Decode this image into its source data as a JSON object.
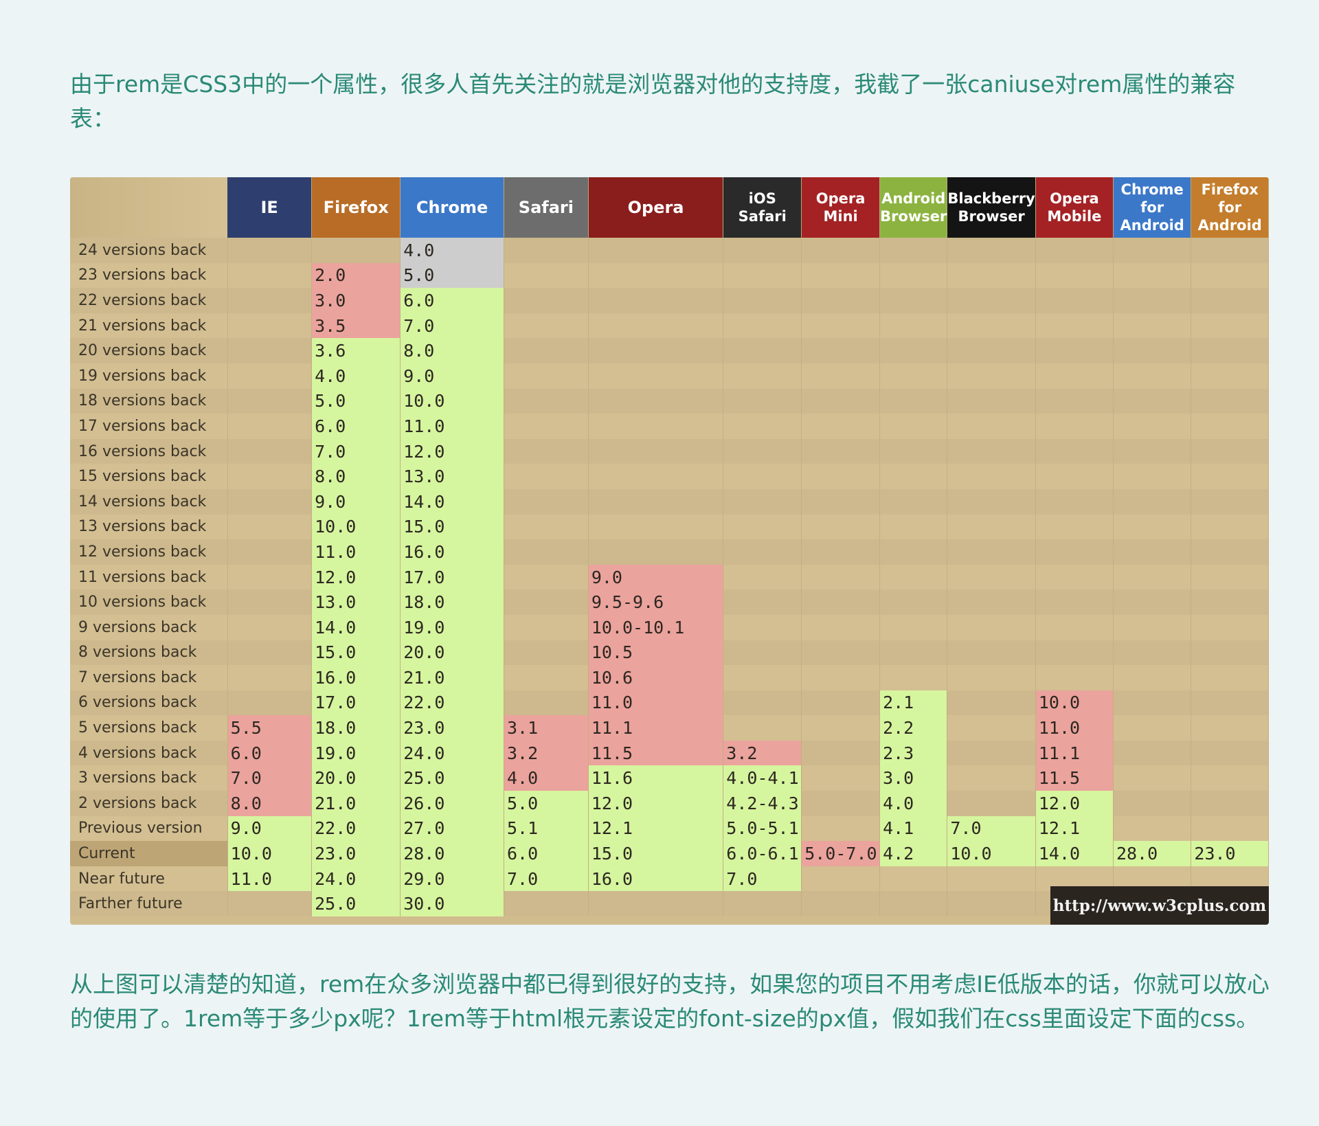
{
  "intro_text": "由于rem是CSS3中的一个属性，很多人首先关注的就是浏览器对他的支持度，我截了一张caniuse对rem属性的兼容表：",
  "outro_text": "从上图可以清楚的知道，rem在众多浏览器中都已得到很好的支持，如果您的项目不用考虑IE低版本的话，你就可以放心的使用了。1rem等于多少px呢？1rem等于html根元素设定的font-size的px值，假如我们在css里面设定下面的css。",
  "credit": "http://www.w3cplus.com",
  "status_colors": {
    "supported": "#d6f59f",
    "not_supported": "#eba39d",
    "unknown": "#cdcdcd"
  },
  "chart_data": {
    "type": "table",
    "columns": [
      {
        "name": "IE",
        "color": "#2e3e6e"
      },
      {
        "name": "Firefox",
        "color": "#b86c26"
      },
      {
        "name": "Chrome",
        "color": "#3c78c8"
      },
      {
        "name": "Safari",
        "color": "#6d6d6d"
      },
      {
        "name": "Opera",
        "color": "#8a1e1c"
      },
      {
        "name": "iOS Safari",
        "color": "#2a2a2a"
      },
      {
        "name": "Opera Mini",
        "color": "#a42224"
      },
      {
        "name": "Android Browser",
        "color": "#8cb340"
      },
      {
        "name": "Blackberry Browser",
        "color": "#141414"
      },
      {
        "name": "Opera Mobile",
        "color": "#a42224"
      },
      {
        "name": "Chrome for Android",
        "color": "#3c78c8"
      },
      {
        "name": "Firefox for Android",
        "color": "#c47d2c"
      }
    ],
    "rows": [
      {
        "label": "24 versions back",
        "cells": [
          null,
          null,
          [
            "4.0",
            "u"
          ],
          null,
          null,
          null,
          null,
          null,
          null,
          null,
          null,
          null
        ]
      },
      {
        "label": "23 versions back",
        "cells": [
          null,
          [
            "2.0",
            "n"
          ],
          [
            "5.0",
            "u"
          ],
          null,
          null,
          null,
          null,
          null,
          null,
          null,
          null,
          null
        ]
      },
      {
        "label": "22 versions back",
        "cells": [
          null,
          [
            "3.0",
            "n"
          ],
          [
            "6.0",
            "y"
          ],
          null,
          null,
          null,
          null,
          null,
          null,
          null,
          null,
          null
        ]
      },
      {
        "label": "21 versions back",
        "cells": [
          null,
          [
            "3.5",
            "n"
          ],
          [
            "7.0",
            "y"
          ],
          null,
          null,
          null,
          null,
          null,
          null,
          null,
          null,
          null
        ]
      },
      {
        "label": "20 versions back",
        "cells": [
          null,
          [
            "3.6",
            "y"
          ],
          [
            "8.0",
            "y"
          ],
          null,
          null,
          null,
          null,
          null,
          null,
          null,
          null,
          null
        ]
      },
      {
        "label": "19 versions back",
        "cells": [
          null,
          [
            "4.0",
            "y"
          ],
          [
            "9.0",
            "y"
          ],
          null,
          null,
          null,
          null,
          null,
          null,
          null,
          null,
          null
        ]
      },
      {
        "label": "18 versions back",
        "cells": [
          null,
          [
            "5.0",
            "y"
          ],
          [
            "10.0",
            "y"
          ],
          null,
          null,
          null,
          null,
          null,
          null,
          null,
          null,
          null
        ]
      },
      {
        "label": "17 versions back",
        "cells": [
          null,
          [
            "6.0",
            "y"
          ],
          [
            "11.0",
            "y"
          ],
          null,
          null,
          null,
          null,
          null,
          null,
          null,
          null,
          null
        ]
      },
      {
        "label": "16 versions back",
        "cells": [
          null,
          [
            "7.0",
            "y"
          ],
          [
            "12.0",
            "y"
          ],
          null,
          null,
          null,
          null,
          null,
          null,
          null,
          null,
          null
        ]
      },
      {
        "label": "15 versions back",
        "cells": [
          null,
          [
            "8.0",
            "y"
          ],
          [
            "13.0",
            "y"
          ],
          null,
          null,
          null,
          null,
          null,
          null,
          null,
          null,
          null
        ]
      },
      {
        "label": "14 versions back",
        "cells": [
          null,
          [
            "9.0",
            "y"
          ],
          [
            "14.0",
            "y"
          ],
          null,
          null,
          null,
          null,
          null,
          null,
          null,
          null,
          null
        ]
      },
      {
        "label": "13 versions back",
        "cells": [
          null,
          [
            "10.0",
            "y"
          ],
          [
            "15.0",
            "y"
          ],
          null,
          null,
          null,
          null,
          null,
          null,
          null,
          null,
          null
        ]
      },
      {
        "label": "12 versions back",
        "cells": [
          null,
          [
            "11.0",
            "y"
          ],
          [
            "16.0",
            "y"
          ],
          null,
          null,
          null,
          null,
          null,
          null,
          null,
          null,
          null
        ]
      },
      {
        "label": "11 versions back",
        "cells": [
          null,
          [
            "12.0",
            "y"
          ],
          [
            "17.0",
            "y"
          ],
          null,
          [
            "9.0",
            "n"
          ],
          null,
          null,
          null,
          null,
          null,
          null,
          null
        ]
      },
      {
        "label": "10 versions back",
        "cells": [
          null,
          [
            "13.0",
            "y"
          ],
          [
            "18.0",
            "y"
          ],
          null,
          [
            "9.5-9.6",
            "n"
          ],
          null,
          null,
          null,
          null,
          null,
          null,
          null
        ]
      },
      {
        "label": "9 versions back",
        "cells": [
          null,
          [
            "14.0",
            "y"
          ],
          [
            "19.0",
            "y"
          ],
          null,
          [
            "10.0-10.1",
            "n"
          ],
          null,
          null,
          null,
          null,
          null,
          null,
          null
        ]
      },
      {
        "label": "8 versions back",
        "cells": [
          null,
          [
            "15.0",
            "y"
          ],
          [
            "20.0",
            "y"
          ],
          null,
          [
            "10.5",
            "n"
          ],
          null,
          null,
          null,
          null,
          null,
          null,
          null
        ]
      },
      {
        "label": "7 versions back",
        "cells": [
          null,
          [
            "16.0",
            "y"
          ],
          [
            "21.0",
            "y"
          ],
          null,
          [
            "10.6",
            "n"
          ],
          null,
          null,
          null,
          null,
          null,
          null,
          null
        ]
      },
      {
        "label": "6 versions back",
        "cells": [
          null,
          [
            "17.0",
            "y"
          ],
          [
            "22.0",
            "y"
          ],
          null,
          [
            "11.0",
            "n"
          ],
          null,
          null,
          [
            "2.1",
            "y"
          ],
          null,
          [
            "10.0",
            "n"
          ],
          null,
          null
        ]
      },
      {
        "label": "5 versions back",
        "cells": [
          [
            "5.5",
            "n"
          ],
          [
            "18.0",
            "y"
          ],
          [
            "23.0",
            "y"
          ],
          [
            "3.1",
            "n"
          ],
          [
            "11.1",
            "n"
          ],
          null,
          null,
          [
            "2.2",
            "y"
          ],
          null,
          [
            "11.0",
            "n"
          ],
          null,
          null
        ]
      },
      {
        "label": "4 versions back",
        "cells": [
          [
            "6.0",
            "n"
          ],
          [
            "19.0",
            "y"
          ],
          [
            "24.0",
            "y"
          ],
          [
            "3.2",
            "n"
          ],
          [
            "11.5",
            "n"
          ],
          [
            "3.2",
            "n"
          ],
          null,
          [
            "2.3",
            "y"
          ],
          null,
          [
            "11.1",
            "n"
          ],
          null,
          null
        ]
      },
      {
        "label": "3 versions back",
        "cells": [
          [
            "7.0",
            "n"
          ],
          [
            "20.0",
            "y"
          ],
          [
            "25.0",
            "y"
          ],
          [
            "4.0",
            "n"
          ],
          [
            "11.6",
            "y"
          ],
          [
            "4.0-4.1",
            "y"
          ],
          null,
          [
            "3.0",
            "y"
          ],
          null,
          [
            "11.5",
            "n"
          ],
          null,
          null
        ]
      },
      {
        "label": "2 versions back",
        "cells": [
          [
            "8.0",
            "n"
          ],
          [
            "21.0",
            "y"
          ],
          [
            "26.0",
            "y"
          ],
          [
            "5.0",
            "y"
          ],
          [
            "12.0",
            "y"
          ],
          [
            "4.2-4.3",
            "y"
          ],
          null,
          [
            "4.0",
            "y"
          ],
          null,
          [
            "12.0",
            "y"
          ],
          null,
          null
        ]
      },
      {
        "label": "Previous version",
        "cells": [
          [
            "9.0",
            "y"
          ],
          [
            "22.0",
            "y"
          ],
          [
            "27.0",
            "y"
          ],
          [
            "5.1",
            "y"
          ],
          [
            "12.1",
            "y"
          ],
          [
            "5.0-5.1",
            "y"
          ],
          null,
          [
            "4.1",
            "y"
          ],
          [
            "7.0",
            "y"
          ],
          [
            "12.1",
            "y"
          ],
          null,
          null
        ]
      },
      {
        "label": "Current",
        "cells": [
          [
            "10.0",
            "y"
          ],
          [
            "23.0",
            "y"
          ],
          [
            "28.0",
            "y"
          ],
          [
            "6.0",
            "y"
          ],
          [
            "15.0",
            "y"
          ],
          [
            "6.0-6.1",
            "y"
          ],
          [
            "5.0-7.0",
            "n"
          ],
          [
            "4.2",
            "y"
          ],
          [
            "10.0",
            "y"
          ],
          [
            "14.0",
            "y"
          ],
          [
            "28.0",
            "y"
          ],
          [
            "23.0",
            "y"
          ]
        ]
      },
      {
        "label": "Near future",
        "cells": [
          [
            "11.0",
            "y"
          ],
          [
            "24.0",
            "y"
          ],
          [
            "29.0",
            "y"
          ],
          [
            "7.0",
            "y"
          ],
          [
            "16.0",
            "y"
          ],
          [
            "7.0",
            "y"
          ],
          null,
          null,
          null,
          null,
          null,
          null
        ]
      },
      {
        "label": "Farther future",
        "cells": [
          null,
          [
            "25.0",
            "y"
          ],
          [
            "30.0",
            "y"
          ],
          null,
          null,
          null,
          null,
          null,
          null,
          null,
          null,
          null
        ]
      }
    ]
  }
}
